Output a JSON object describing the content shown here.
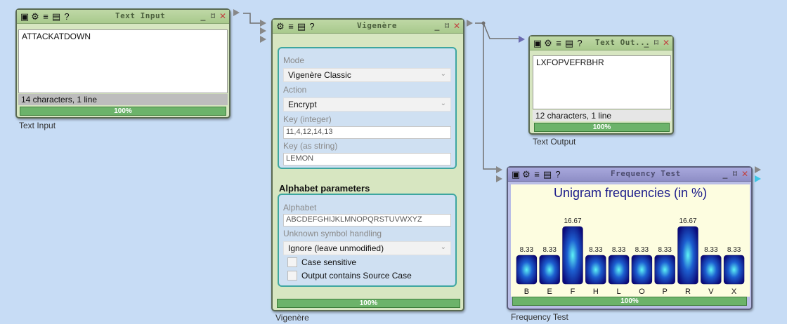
{
  "text_input": {
    "title": "Text Input",
    "value": "ATTACKATDOWN",
    "status": "14 characters,  1 line",
    "progress": "100%",
    "label": "Text Input"
  },
  "vigenere": {
    "title": "Vigenère",
    "mode_label": "Mode",
    "mode_value": "Vigenère Classic",
    "action_label": "Action",
    "action_value": "Encrypt",
    "key_int_label": "Key (integer)",
    "key_int_value": "11,4,12,14,13",
    "key_str_label": "Key (as string)",
    "key_str_value": "LEMON",
    "alpha_section": "Alphabet parameters",
    "alphabet_label": "Alphabet",
    "alphabet_value": "ABCDEFGHIJKLMNOPQRSTUVWXYZ",
    "unknown_label": "Unknown symbol handling",
    "unknown_value": "Ignore (leave unmodified)",
    "case_sensitive": "Case sensitive",
    "output_case": "Output contains Source Case",
    "progress": "100%",
    "label": "Vigenère"
  },
  "text_output": {
    "title": "Text Out...",
    "value": "LXFOPVEFRBHR",
    "status": "12 characters,  1 line",
    "progress": "100%",
    "label": "Text Output"
  },
  "frequency": {
    "title": "Frequency Test",
    "progress": "100%",
    "label": "Frequency Test"
  },
  "chart_data": {
    "type": "bar",
    "title": "Unigram frequencies (in %)",
    "categories": [
      "B",
      "E",
      "F",
      "H",
      "L",
      "O",
      "P",
      "R",
      "V",
      "X"
    ],
    "values": [
      8.33,
      8.33,
      16.67,
      8.33,
      8.33,
      8.33,
      8.33,
      16.67,
      8.33,
      8.33
    ],
    "value_labels": [
      "8.33",
      "8.33",
      "16.67",
      "8.33",
      "8.33",
      "8.33",
      "8.33",
      "16.67",
      "8.33",
      "8.33"
    ],
    "ylim": [
      0,
      16.67
    ]
  },
  "icons": {
    "toolbar": [
      "image-icon",
      "gear-icon",
      "list-icon",
      "clipboard-icon",
      "help-icon"
    ],
    "window": [
      "minimize-icon",
      "maximize-icon",
      "close-icon"
    ]
  }
}
